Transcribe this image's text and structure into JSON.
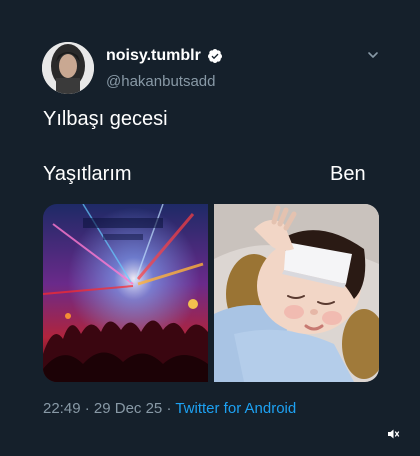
{
  "user": {
    "display_name": "noisy.tumblr",
    "handle": "@hakanbutsadd",
    "verified": true
  },
  "tweet": {
    "text": "Yılbaşı gecesi",
    "label_left": "Yaşıtlarım",
    "label_right": "Ben",
    "time": "22:49",
    "separator": " · ",
    "date": "29 Dec 25",
    "source": "Twitter for Android"
  },
  "media": {
    "left_description_icon": "concert-crowd-photo",
    "right_description_icon": "sleeping-baby-photo"
  },
  "colors": {
    "background": "#15202b",
    "secondary_text": "#8899a6",
    "link": "#1da1f2",
    "verified": "#ffffff"
  },
  "icons": {
    "verified": "verified-badge-icon",
    "caret": "chevron-down-icon",
    "mute": "volume-muted-icon"
  }
}
